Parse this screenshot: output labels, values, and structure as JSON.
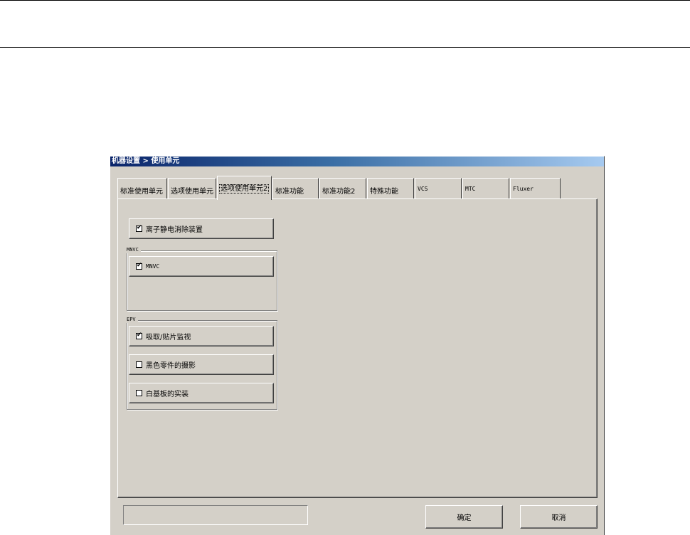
{
  "window": {
    "title": "机器设置 > 使用单元"
  },
  "tabs": [
    {
      "label": "标准使用单元"
    },
    {
      "label": "选项使用单元"
    },
    {
      "label": "选项使用单元2"
    },
    {
      "label": "标准功能"
    },
    {
      "label": "标准功能2"
    },
    {
      "label": "特殊功能"
    },
    {
      "label": "VCS"
    },
    {
      "label": "MTC"
    },
    {
      "label": "Fluxer"
    }
  ],
  "active_tab": "选项使用单元2",
  "options": {
    "ionizer": {
      "label": "离子静电消除装置",
      "checked": true
    }
  },
  "groups": {
    "mnvc": {
      "title": "MNVC",
      "items": [
        {
          "label": "MNVC",
          "checked": true
        }
      ]
    },
    "epv": {
      "title": "EPV",
      "items": [
        {
          "label": "吸取/贴片监视",
          "checked": true
        },
        {
          "label": "黑色零件的摄影",
          "checked": false
        },
        {
          "label": "白基板的实装",
          "checked": false
        }
      ]
    }
  },
  "footer": {
    "status_text": "",
    "ok_label": "确定",
    "cancel_label": "取消"
  },
  "check_mark": "✔"
}
